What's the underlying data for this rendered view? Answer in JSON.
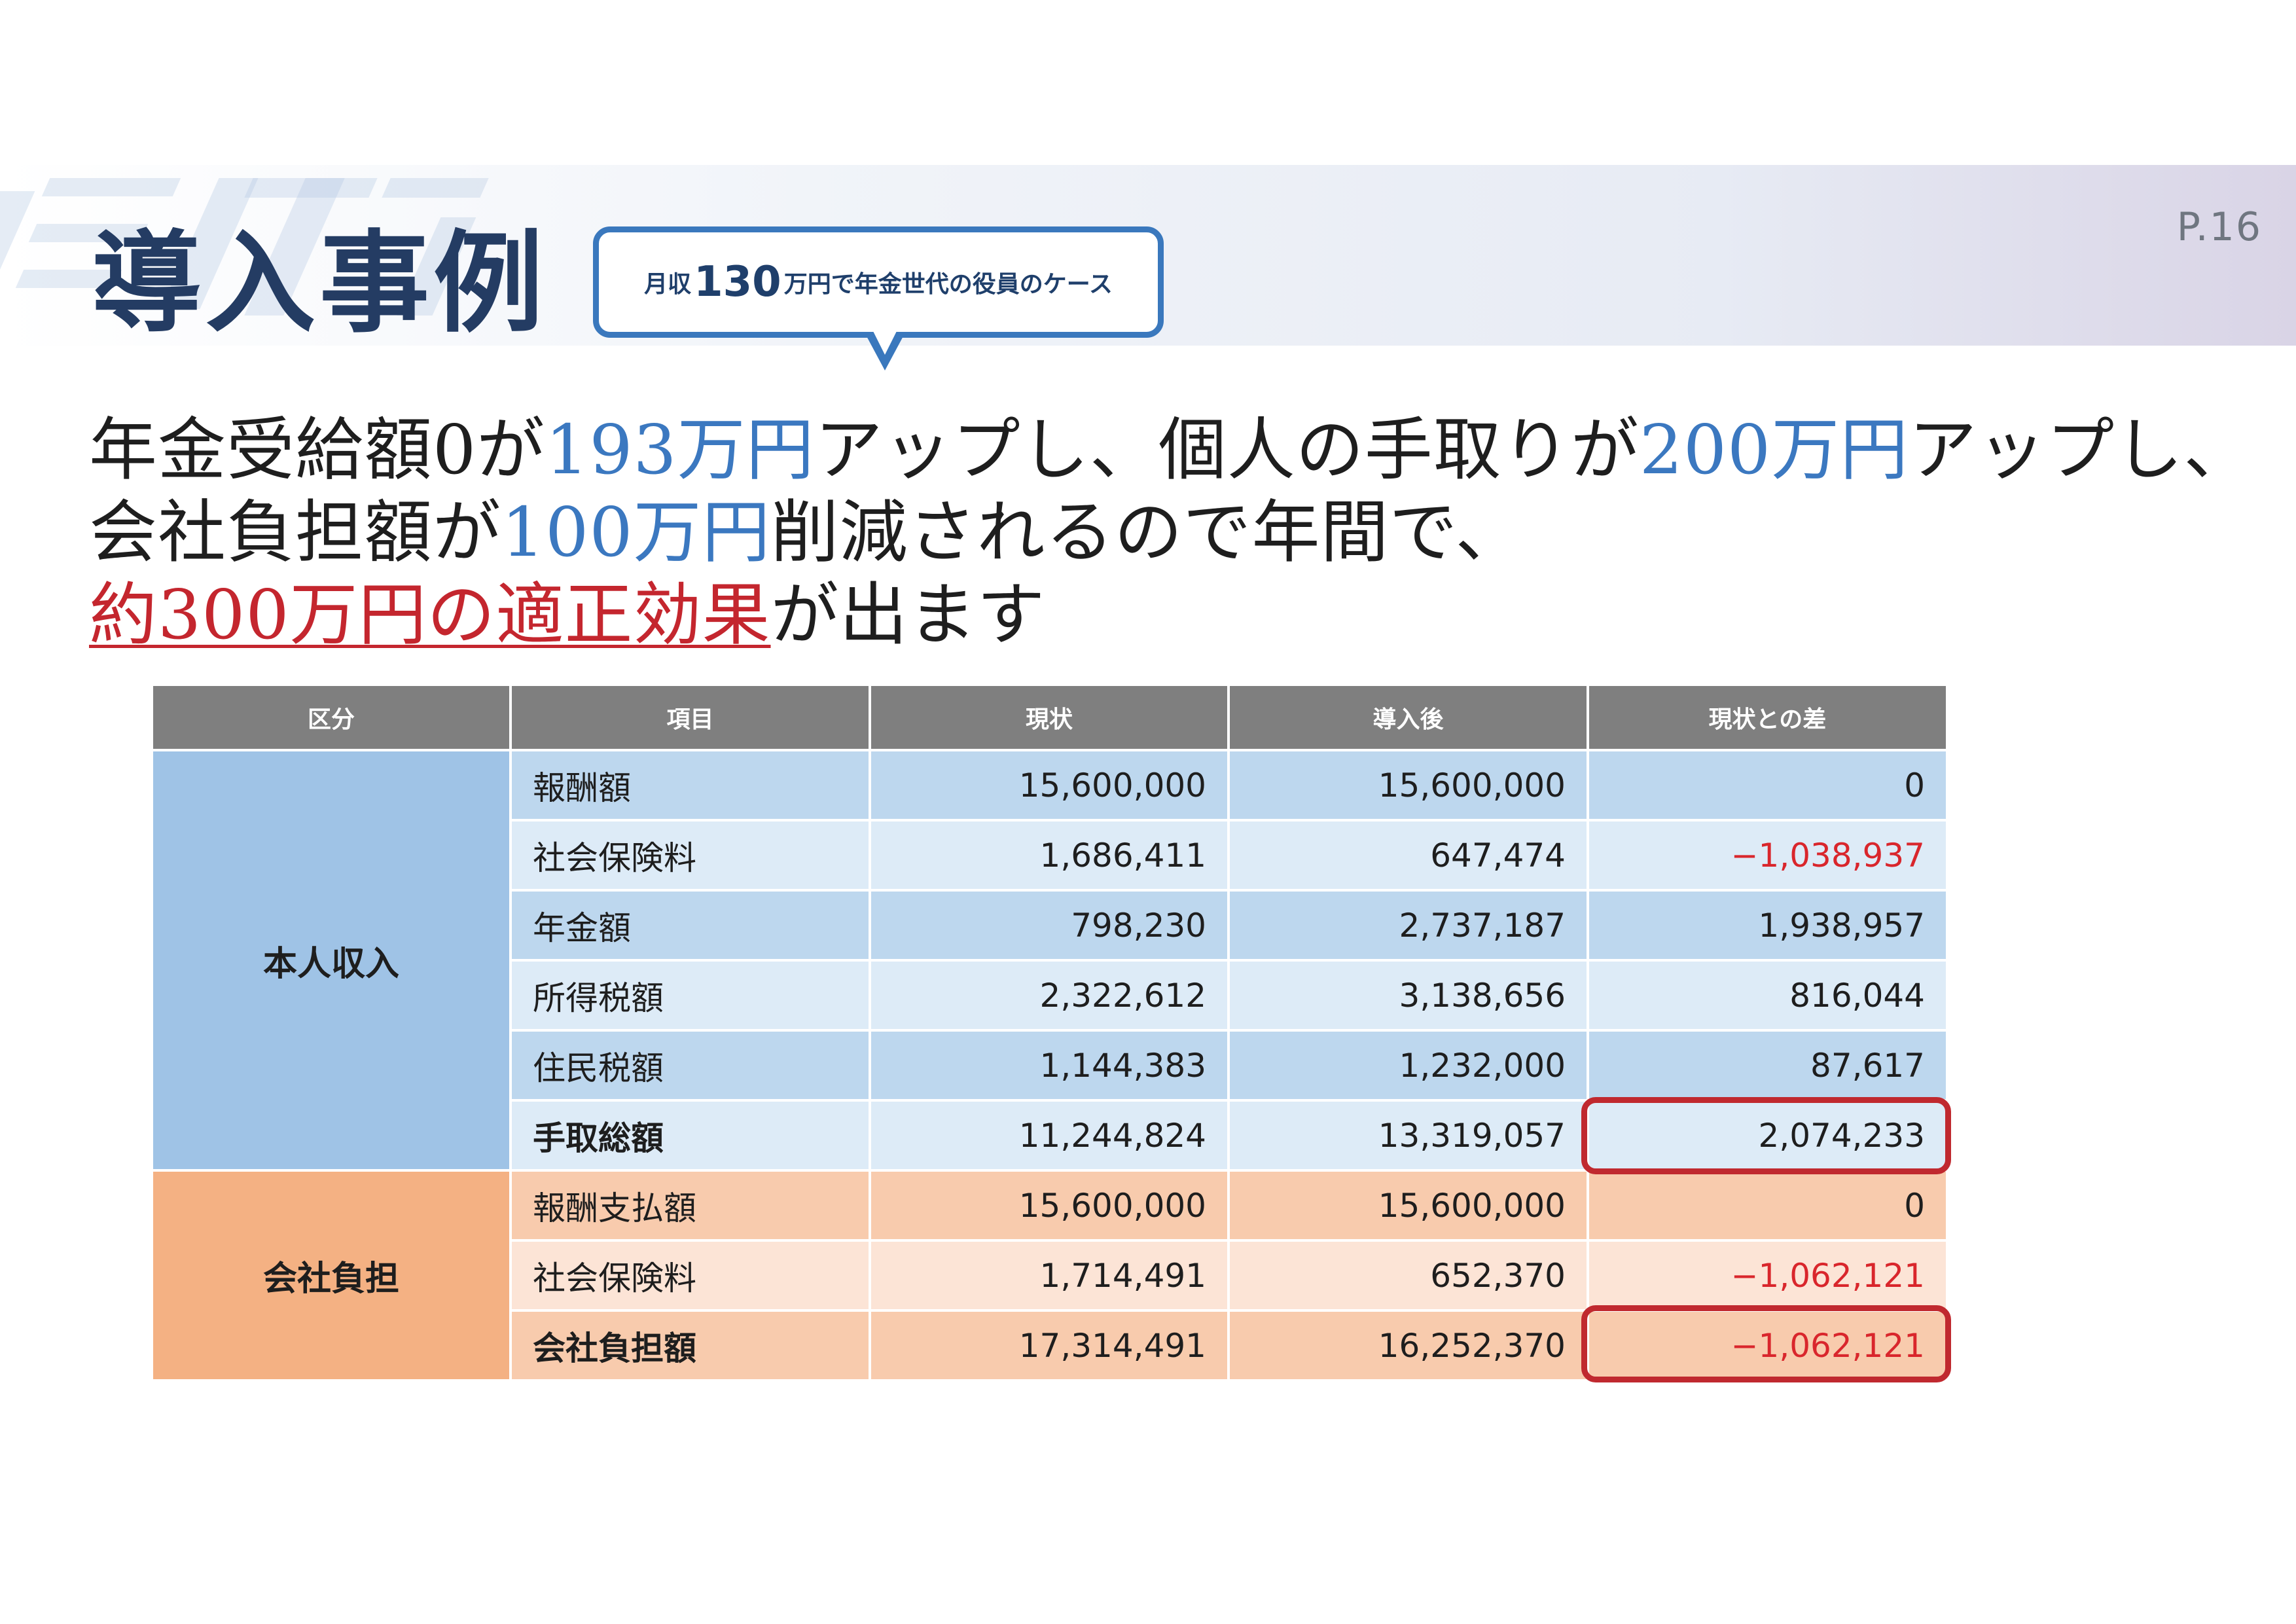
{
  "page_number": "P.16",
  "title": "導入事例",
  "bubble": {
    "prefix": "月収",
    "number": "130",
    "suffix": "万円で年金世代の役員のケース"
  },
  "headline": {
    "line1": [
      {
        "text": "年金受給額0が",
        "style": "normal"
      },
      {
        "text": "193万円",
        "style": "blue"
      },
      {
        "text": "アップし、個人の手取りが",
        "style": "normal"
      },
      {
        "text": "200万円",
        "style": "blue"
      },
      {
        "text": "アップし、",
        "style": "normal"
      }
    ],
    "line2": [
      {
        "text": "会社負担額が",
        "style": "normal"
      },
      {
        "text": "100万円",
        "style": "blue"
      },
      {
        "text": "削減されるので年間で、",
        "style": "normal"
      }
    ],
    "line3": [
      {
        "text": "約300万円の適正効果",
        "style": "red"
      },
      {
        "text": "が出ます",
        "style": "normal"
      }
    ]
  },
  "table": {
    "headers": [
      "区分",
      "項目",
      "現状",
      "導入後",
      "現状との差"
    ],
    "groups": {
      "personal": "本人収入",
      "company": "会社負担"
    },
    "personal_rows": [
      {
        "item": "報酬額",
        "current": "15,600,000",
        "after": "15,600,000",
        "diff": "0",
        "negative": false,
        "bold": false
      },
      {
        "item": "社会保険料",
        "current": "1,686,411",
        "after": "647,474",
        "diff": "−1,038,937",
        "negative": true,
        "bold": false
      },
      {
        "item": "年金額",
        "current": "798,230",
        "after": "2,737,187",
        "diff": "1,938,957",
        "negative": false,
        "bold": false
      },
      {
        "item": "所得税額",
        "current": "2,322,612",
        "after": "3,138,656",
        "diff": "816,044",
        "negative": false,
        "bold": false
      },
      {
        "item": "住民税額",
        "current": "1,144,383",
        "after": "1,232,000",
        "diff": "87,617",
        "negative": false,
        "bold": false
      },
      {
        "item": "手取総額",
        "current": "11,244,824",
        "after": "13,319,057",
        "diff": "2,074,233",
        "negative": false,
        "bold": true
      }
    ],
    "company_rows": [
      {
        "item": "報酬支払額",
        "current": "15,600,000",
        "after": "15,600,000",
        "diff": "0",
        "negative": false,
        "bold": false
      },
      {
        "item": "社会保険料",
        "current": "1,714,491",
        "after": "652,370",
        "diff": "−1,062,121",
        "negative": true,
        "bold": false
      },
      {
        "item": "会社負担額",
        "current": "17,314,491",
        "after": "16,252,370",
        "diff": "−1,062,121",
        "negative": true,
        "bold": true
      }
    ]
  },
  "colors": {
    "title": "#243c63",
    "accent_blue": "#3b78c0",
    "accent_red": "#c4262e",
    "header_gray": "#7f7f7f",
    "personal_group": "#9fc3e6",
    "company_group": "#f4b183",
    "negative": "#d9262c"
  }
}
